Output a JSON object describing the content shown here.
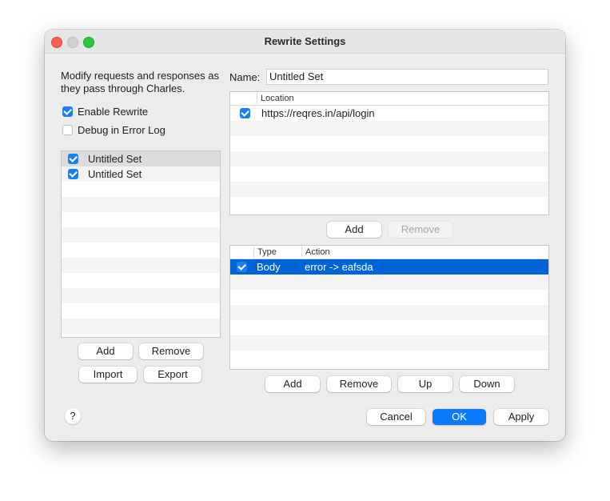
{
  "window": {
    "title": "Rewrite Settings"
  },
  "left": {
    "description": "Modify requests and responses as they pass through Charles.",
    "enable_rewrite": {
      "label": "Enable Rewrite",
      "checked": true
    },
    "debug_error_log": {
      "label": "Debug in Error Log",
      "checked": false
    },
    "sets": [
      {
        "label": "Untitled Set",
        "checked": true,
        "selected": true
      },
      {
        "label": "Untitled Set",
        "checked": true,
        "selected": false
      }
    ],
    "buttons": {
      "add": "Add",
      "remove": "Remove",
      "import": "Import",
      "export": "Export"
    }
  },
  "right": {
    "name_label": "Name:",
    "name_value": "Untitled Set",
    "locations": {
      "columns": [
        "Location"
      ],
      "rows": [
        {
          "checked": true,
          "location": "https://reqres.in/api/login"
        }
      ],
      "buttons": {
        "add": "Add",
        "remove": "Remove"
      }
    },
    "rules": {
      "columns": [
        "Type",
        "Action"
      ],
      "rows": [
        {
          "checked": true,
          "type": "Body",
          "action": "error -> eafsda",
          "selected": true
        }
      ],
      "buttons": {
        "add": "Add",
        "remove": "Remove",
        "up": "Up",
        "down": "Down"
      }
    }
  },
  "footer": {
    "help": "?",
    "cancel": "Cancel",
    "ok": "OK",
    "apply": "Apply"
  },
  "colors": {
    "accent": "#0a7bff",
    "selection": "#0064d9",
    "checkbox": "#1a7ff5"
  }
}
